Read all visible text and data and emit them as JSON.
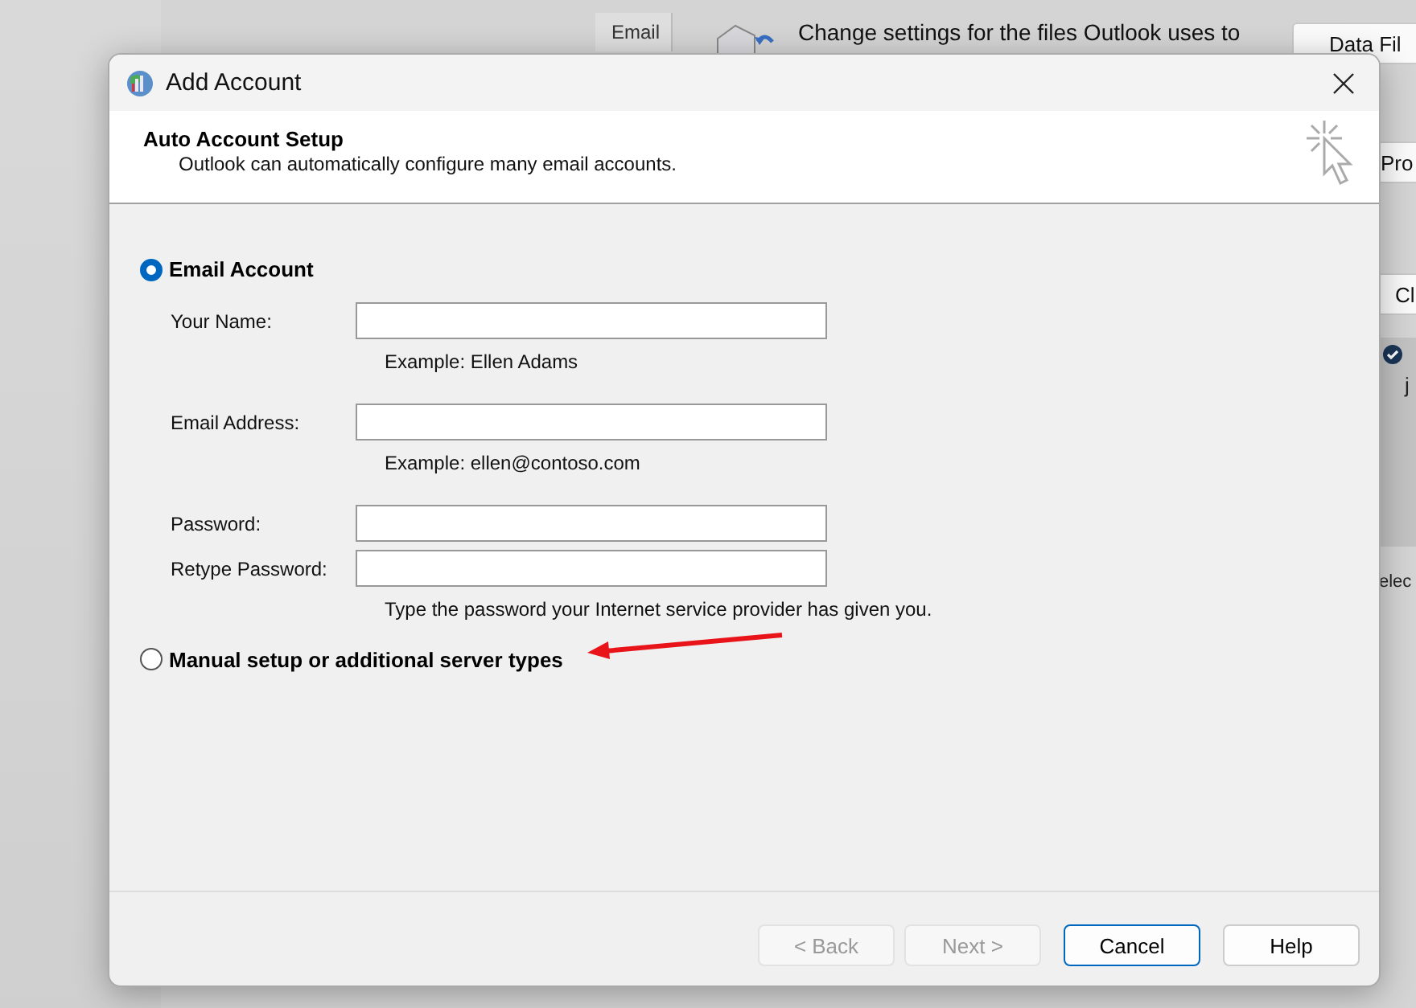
{
  "background_window": {
    "tab": "Email",
    "description": "Change settings for the files Outlook uses to",
    "buttons": [
      "Data Fil",
      "Pro",
      "Cl"
    ],
    "list_item": {
      "subtitle": "j"
    },
    "footer_text": "elec"
  },
  "dialog": {
    "title": "Add Account",
    "header": {
      "title": "Auto Account Setup",
      "subtitle": "Outlook can automatically configure many email accounts."
    },
    "options": [
      {
        "label": "Email Account",
        "selected": true,
        "fields": [
          {
            "label": "Your Name:",
            "hint": "Example: Ellen Adams"
          },
          {
            "label": "Email Address:",
            "hint": "Example: ellen@contoso.com"
          },
          {
            "label": "Password:"
          },
          {
            "label": "Retype Password:",
            "hint": "Type the password your Internet service provider has given you."
          }
        ]
      },
      {
        "label": "Manual setup or additional server types",
        "selected": false
      }
    ],
    "buttons": [
      {
        "label": "< Back",
        "disabled": true,
        "focused": false
      },
      {
        "label": "Next >",
        "disabled": true,
        "focused": false
      },
      {
        "label": "Cancel",
        "disabled": false,
        "focused": true
      },
      {
        "label": "Help",
        "disabled": false,
        "focused": false
      }
    ]
  }
}
